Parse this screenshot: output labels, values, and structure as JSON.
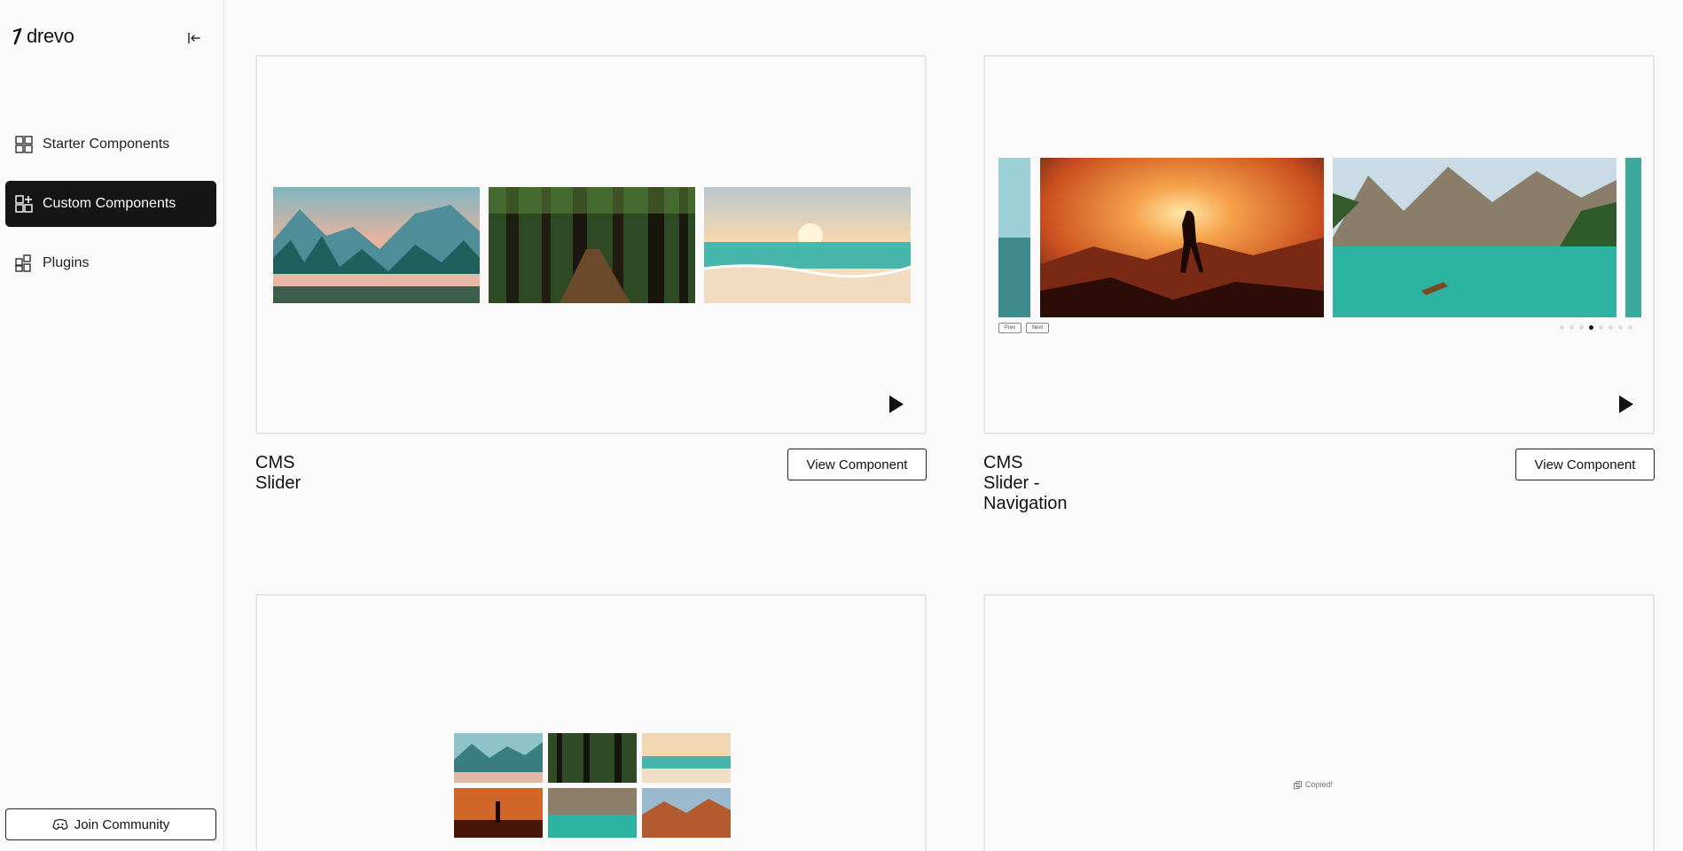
{
  "brand": {
    "name": "drevo"
  },
  "sidebar": {
    "collapse_icon": "collapse-left-icon",
    "items": [
      {
        "label": "Starter Components",
        "icon": "grid-icon",
        "active": false
      },
      {
        "label": "Custom Components",
        "icon": "grid-plus-icon",
        "active": true
      },
      {
        "label": "Plugins",
        "icon": "plugin-grid-icon",
        "active": false
      }
    ],
    "join_label": "Join Community",
    "join_icon": "discord-icon"
  },
  "cards": [
    {
      "title": "CMS Slider",
      "button": "View Component"
    },
    {
      "title": "CMS Slider - Navigation",
      "button": "View Component",
      "prev_label": "Prev",
      "next_label": "Next"
    },
    {
      "title": "",
      "button": ""
    },
    {
      "title": "",
      "button": "",
      "copied_label": "Copied!"
    }
  ],
  "colors": {
    "active_bg": "#151515",
    "border": "#e5e5e5",
    "page_bg": "#fafafa"
  }
}
